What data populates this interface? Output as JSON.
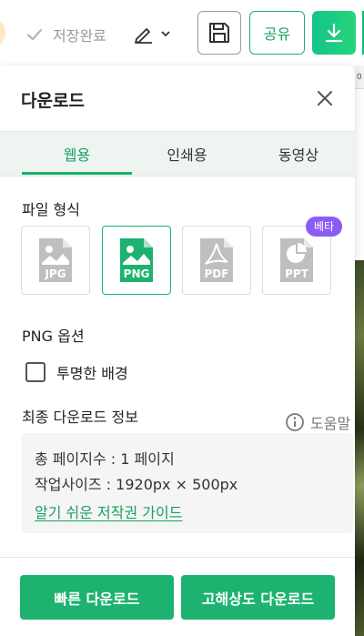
{
  "toolbar": {
    "save_status": "저장완료",
    "share_label": "공유",
    "icons": {
      "check": "check-icon",
      "pencil": "pencil-icon",
      "chevron": "chevron-down-icon",
      "save": "floppy-disk-icon",
      "download": "download-icon"
    }
  },
  "background": {
    "ruler_text": "0"
  },
  "panel": {
    "title": "다운로드",
    "tabs": [
      {
        "label": "웹용",
        "active": true
      },
      {
        "label": "인쇄용",
        "active": false
      },
      {
        "label": "동영상",
        "active": false
      }
    ],
    "file_format": {
      "label": "파일 형식",
      "formats": [
        {
          "label": "JPG",
          "selected": false
        },
        {
          "label": "PNG",
          "selected": true
        },
        {
          "label": "PDF",
          "selected": false
        },
        {
          "label": "PPT",
          "selected": false
        }
      ],
      "beta_badge": "베타"
    },
    "options": {
      "label": "PNG 옵션",
      "transparent_label": "투명한 배경",
      "transparent_checked": false
    },
    "final_info": {
      "label": "최종 다운로드 정보",
      "help_label": "도움말",
      "total_pages": "총 페이지수 : 1 페이지",
      "work_size": "작업사이즈 : 1920px × 500px",
      "guide_link": "알기 쉬운 저작권 가이드"
    },
    "buttons": {
      "fast": "빠른 다운로드",
      "hq": "고해상도 다운로드"
    }
  },
  "colors": {
    "accent": "#19b26b",
    "accent_text": "#17a05f",
    "beta": "#8b5cf6",
    "tab_bg": "#eef5f1"
  }
}
